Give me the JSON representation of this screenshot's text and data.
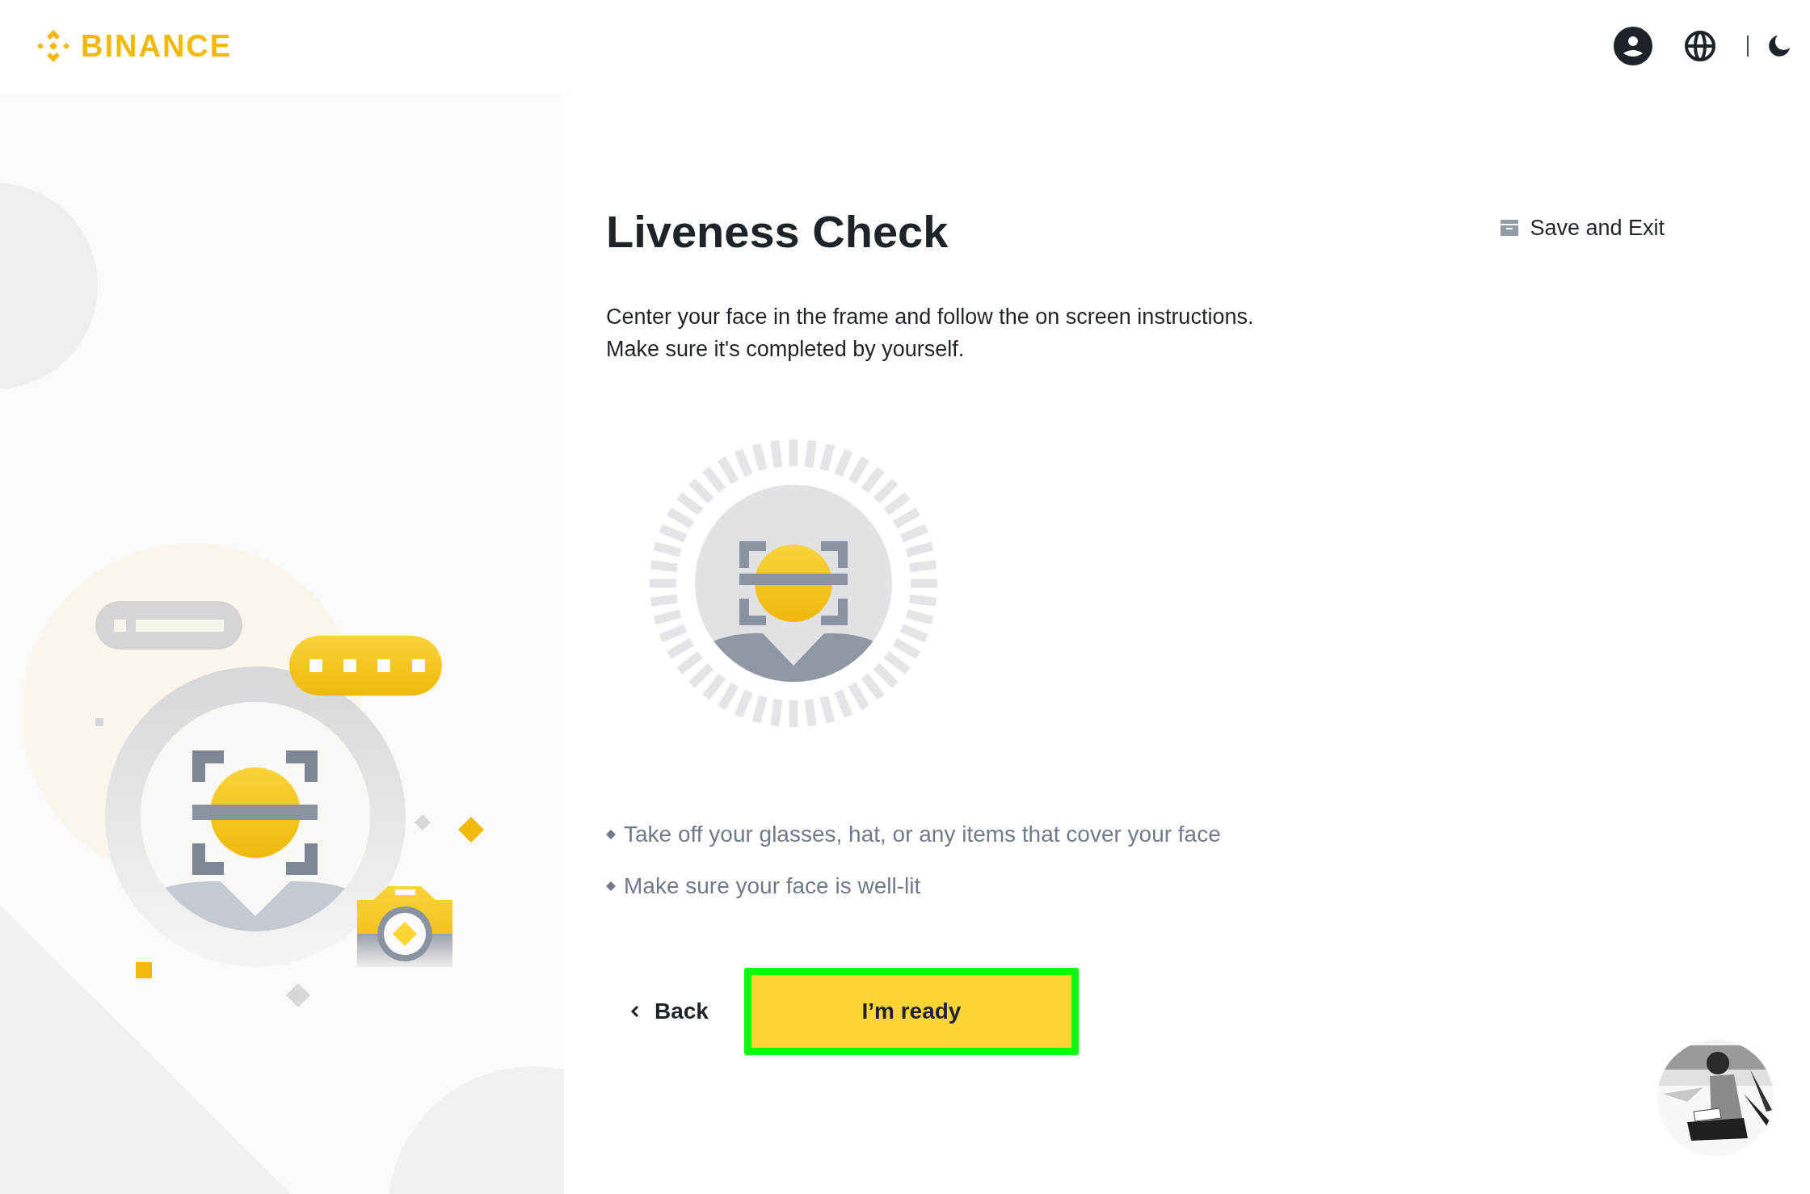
{
  "header": {
    "logo_text": "BINANCE"
  },
  "save_exit": "Save and Exit",
  "title": "Liveness Check",
  "description": [
    "Center your face in the frame and follow the on screen instructions.",
    "Make sure it's completed by yourself."
  ],
  "tips": [
    "Take off your glasses, hat, or any items that cover your face",
    "Make sure your face is well-lit"
  ],
  "back_button": "Back",
  "primary_button": {
    "label": "I’m ready",
    "highlighted": true
  }
}
